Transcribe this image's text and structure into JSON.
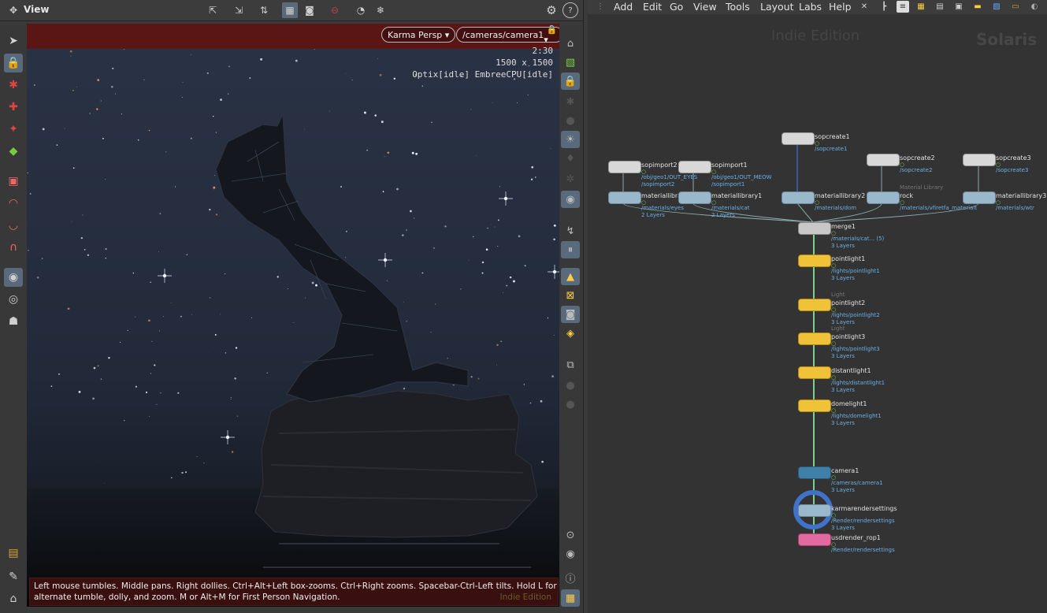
{
  "viewport_pane": {
    "title": "View",
    "renderer_button": "Karma Persp",
    "camera_button": "/cameras/camera1",
    "hud": {
      "zoom": "2:30",
      "resolution": "1500 x 1500",
      "render_status": "Optix[idle] EmbreeCPU[idle]"
    },
    "status_message": "Left mouse tumbles. Middle pans. Right dollies. Ctrl+Alt+Left box-zooms. Ctrl+Right zooms. Spacebar-Ctrl-Left tilts. Hold L for alternate tumble, dolly, and zoom.     M or Alt+M for First Person Navigation.",
    "edition_watermark": "Indie Edition"
  },
  "network_pane": {
    "menu": [
      "Add",
      "Edit",
      "Go",
      "View",
      "Tools",
      "Layout",
      "Labs",
      "Help"
    ],
    "edition_label": "Indie Edition",
    "context_label": "Solaris",
    "nodes": [
      {
        "name": "sopcreate1",
        "path": "/sopcreate1",
        "type": "",
        "layers": "",
        "kind": "sop"
      },
      {
        "name": "sopimport2",
        "path": "/obj/geo1/OUT_EYES",
        "path2": "/sopimport2",
        "type": "",
        "layers": "",
        "kind": "sop"
      },
      {
        "name": "sopimport1",
        "path": "/obj/geo1/OUT_MEOW",
        "path2": "/sopimport1",
        "type": "",
        "layers": "",
        "kind": "sop"
      },
      {
        "name": "sopcreate2",
        "path": "/sopcreate2",
        "type": "",
        "layers": "",
        "kind": "sop"
      },
      {
        "name": "sopcreate3",
        "path": "/sopcreate3",
        "type": "",
        "layers": "",
        "kind": "sop"
      },
      {
        "name": "materiallibrary",
        "path": "/materials/eyes",
        "type": "",
        "layers": "2 Layers",
        "kind": "mat"
      },
      {
        "name": "materiallibrary1",
        "path": "/materials/cat",
        "type": "",
        "layers": "2 Layers",
        "kind": "mat"
      },
      {
        "name": "materiallibrary2",
        "path": "/materials/dom",
        "type": "",
        "layers": "",
        "kind": "mat"
      },
      {
        "name": "rock",
        "path": "/materials/vfiretfa_materialt",
        "type": "Material Library",
        "layers": "",
        "kind": "mat"
      },
      {
        "name": "materiallibrary3",
        "path": "/materials/wtr",
        "type": "",
        "layers": "",
        "kind": "mat"
      },
      {
        "name": "merge1",
        "path": "/materials/cat... (5)",
        "type": "",
        "layers": "3 Layers",
        "kind": "merge"
      },
      {
        "name": "pointlight1",
        "path": "/lights/pointlight1",
        "type": "",
        "layers": "3 Layers",
        "kind": "light"
      },
      {
        "name": "pointlight2",
        "path": "/lights/pointlight2",
        "type": "Light",
        "layers": "3 Layers",
        "kind": "light"
      },
      {
        "name": "pointlight3",
        "path": "/lights/pointlight3",
        "type": "Light",
        "layers": "3 Layers",
        "kind": "light"
      },
      {
        "name": "distantlight1",
        "path": "/lights/distantlight1",
        "type": "",
        "layers": "3 Layers",
        "kind": "light"
      },
      {
        "name": "domelight1",
        "path": "/lights/domelight1",
        "type": "",
        "layers": "3 Layers",
        "kind": "light"
      },
      {
        "name": "camera1",
        "path": "/cameras/camera1",
        "type": "",
        "layers": "3 Layers",
        "kind": "camera"
      },
      {
        "name": "karmarendersettings",
        "path": "/Render/rendersettings",
        "type": "",
        "layers": "3 Layers",
        "kind": "render"
      },
      {
        "name": "usdrender_rop1",
        "path": "/Render/rendersettings",
        "type": "",
        "layers": "",
        "kind": "rop"
      }
    ]
  },
  "colors": {
    "render_bar": "#5a1515",
    "node_light": "#f0c23a",
    "node_path": "#6ab0e8",
    "selected_ring": "#3f72c8"
  }
}
